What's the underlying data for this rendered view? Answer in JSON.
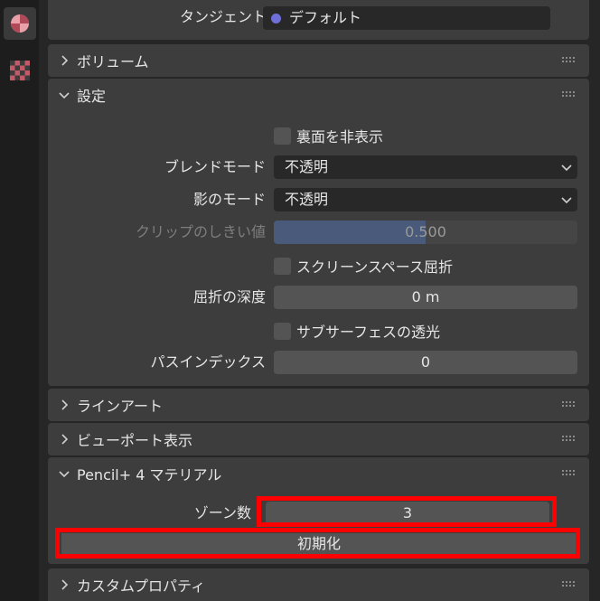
{
  "sidebar": {
    "tabs": [
      {
        "icon": "material-icon",
        "active": true
      },
      {
        "icon": "checker-texture-icon",
        "active": false
      }
    ]
  },
  "tangent_row": {
    "label": "タンジェント",
    "value": "デフォルト"
  },
  "panels": {
    "volume": {
      "title": "ボリューム"
    },
    "settings": {
      "title": "設定",
      "backface_label": "裏面を非表示",
      "blend_mode_label": "ブレンドモード",
      "blend_mode_value": "不透明",
      "shadow_mode_label": "影のモード",
      "shadow_mode_value": "不透明",
      "clip_threshold_label": "クリップのしきい値",
      "clip_threshold_value": "0.500",
      "clip_threshold_fraction": 0.5,
      "screen_refraction_label": "スクリーンスペース屈折",
      "refraction_depth_label": "屈折の深度",
      "refraction_depth_value": "0 m",
      "sss_translucency_label": "サブサーフェスの透光",
      "pass_index_label": "パスインデックス",
      "pass_index_value": "0"
    },
    "lineart": {
      "title": "ラインアート"
    },
    "viewport_display": {
      "title": "ビューポート表示"
    },
    "pencil": {
      "title": "Pencil+ 4 マテリアル",
      "zones_label": "ゾーン数",
      "zones_value": "3",
      "reset_label": "初期化"
    },
    "custom_props": {
      "title": "カスタムプロパティ"
    }
  },
  "colors": {
    "highlight": "#ff0000",
    "slider_fill": "#4a5a7a",
    "dot": "#6f6fd8"
  }
}
